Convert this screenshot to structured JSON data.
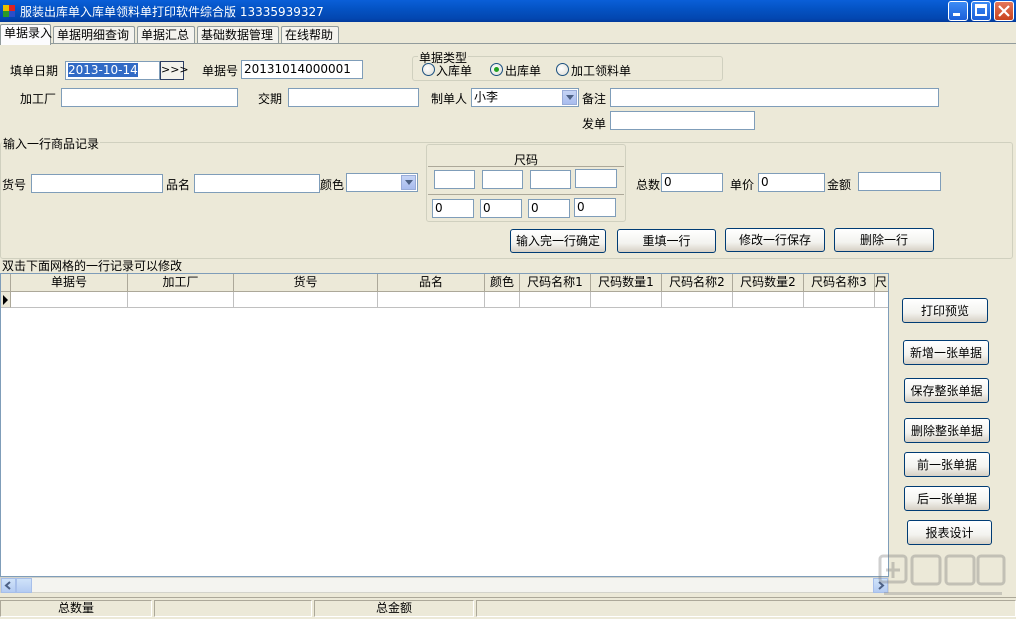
{
  "window": {
    "title": "服装出库单入库单领料单打印软件综合版 13335939327"
  },
  "tabs": [
    {
      "label": "单据录入",
      "active": true
    },
    {
      "label": "单据明细查询",
      "active": false
    },
    {
      "label": "单据汇总",
      "active": false
    },
    {
      "label": "基础数据管理",
      "active": false
    },
    {
      "label": "在线帮助",
      "active": false
    }
  ],
  "header_form": {
    "date_label": "填单日期",
    "date_value": "2013-10-14",
    "date_button": ">>>",
    "doc_no_label": "单据号",
    "doc_no_value": "20131014000001",
    "doc_type_group": "单据类型",
    "doc_types": [
      {
        "label": "入库单",
        "checked": false
      },
      {
        "label": "出库单",
        "checked": true
      },
      {
        "label": "加工领料单",
        "checked": false
      }
    ],
    "factory_label": "加工厂",
    "factory_value": "",
    "due_label": "交期",
    "due_value": "",
    "maker_label": "制单人",
    "maker_value": "小李",
    "remark_label": "备注",
    "remark_value": "",
    "sender_label": "发单",
    "sender_value": ""
  },
  "line_entry": {
    "group_title": "输入一行商品记录",
    "item_no_label": "货号",
    "item_name_label": "品名",
    "color_label": "颜色",
    "size_group_title": "尺码",
    "size_qtys": [
      "0",
      "0",
      "0",
      "0"
    ],
    "total_label": "总数",
    "total_value": "0",
    "price_label": "单价",
    "price_value": "0",
    "amount_label": "金额",
    "amount_value": "",
    "buttons": {
      "confirm": "输入完一行确定",
      "refill": "重填一行",
      "save_edit": "修改一行保存",
      "delete_row": "删除一行"
    }
  },
  "grid": {
    "caption": "双击下面网格的一行记录可以修改",
    "columns": [
      "单据号",
      "加工厂",
      "货号",
      "品名",
      "颜色",
      "尺码名称1",
      "尺码数量1",
      "尺码名称2",
      "尺码数量2",
      "尺码名称3",
      "尺"
    ]
  },
  "side_buttons": {
    "print_preview": "打印预览",
    "new_doc": "新增一张单据",
    "save_doc": "保存整张单据",
    "delete_doc": "删除整张单据",
    "prev_doc": "前一张单据",
    "next_doc": "后一张单据",
    "report_design": "报表设计"
  },
  "status": {
    "total_qty_label": "总数量",
    "total_amount_label": "总金额"
  },
  "colors": {
    "titlebar": "#0453c4",
    "window_bg": "#ece9d8",
    "selection": "#316ac5"
  }
}
